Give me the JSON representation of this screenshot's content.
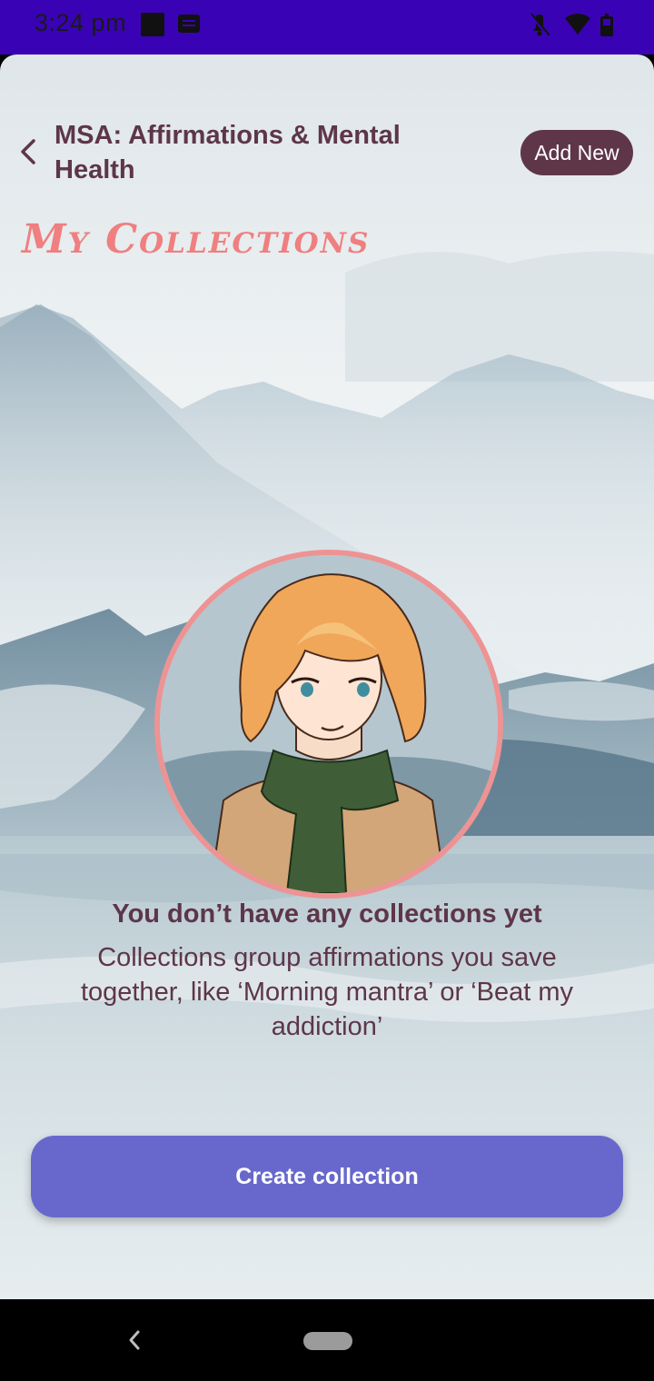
{
  "status_bar": {
    "time": "3:24 pm",
    "icons": [
      "notifications-off-icon",
      "wifi-icon",
      "battery-icon"
    ]
  },
  "header": {
    "title": "MSA: Affirmations & Mental Health",
    "add_new_label": "Add New"
  },
  "page": {
    "heading": "My Collections"
  },
  "empty_state": {
    "title": "You don’t have any collections yet",
    "description": "Collections group affirmations you save together, like ‘Morning mantra’ or ‘Beat my addiction’"
  },
  "actions": {
    "create_label": "Create collection"
  },
  "colors": {
    "status_bar": "#3a02b5",
    "title_text": "#5d3649",
    "heading_accent": "#ef7f80",
    "add_new_bg": "#5e3648",
    "create_button_bg": "#6868cc",
    "avatar_border": "#ee9393"
  }
}
